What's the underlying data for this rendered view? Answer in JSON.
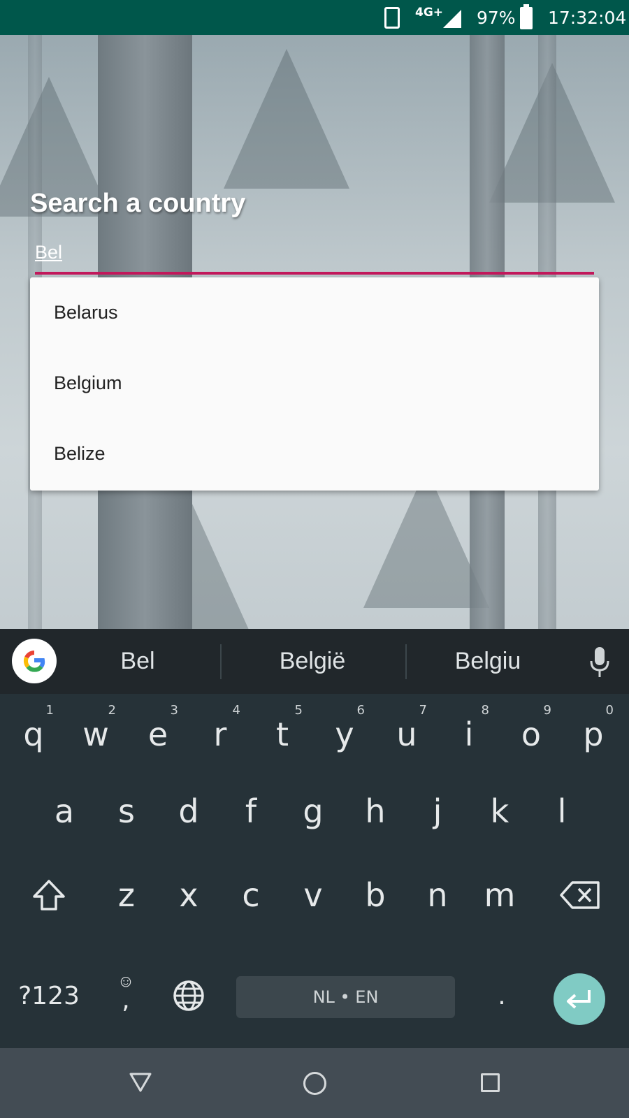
{
  "status_bar": {
    "network": "4G+",
    "battery": "97%",
    "time": "17:32:04"
  },
  "page": {
    "title": "Search a country",
    "search_value": "Bel"
  },
  "dropdown": {
    "items": [
      "Belarus",
      "Belgium",
      "Belize"
    ]
  },
  "keyboard": {
    "suggestions": [
      "Bel",
      "België",
      "Belgiu"
    ],
    "row1": [
      {
        "key": "q",
        "hint": "1"
      },
      {
        "key": "w",
        "hint": "2"
      },
      {
        "key": "e",
        "hint": "3"
      },
      {
        "key": "r",
        "hint": "4"
      },
      {
        "key": "t",
        "hint": "5"
      },
      {
        "key": "y",
        "hint": "6"
      },
      {
        "key": "u",
        "hint": "7"
      },
      {
        "key": "i",
        "hint": "8"
      },
      {
        "key": "o",
        "hint": "9"
      },
      {
        "key": "p",
        "hint": "0"
      }
    ],
    "row2": [
      "a",
      "s",
      "d",
      "f",
      "g",
      "h",
      "j",
      "k",
      "l"
    ],
    "row3": [
      "z",
      "x",
      "c",
      "v",
      "b",
      "n",
      "m"
    ],
    "symbols_label": "?123",
    "comma_label": ",",
    "space_label": "NL • EN",
    "period_label": "."
  },
  "colors": {
    "status_bar": "#00574b",
    "accent": "#c2185b",
    "enter_key": "#80cbc4",
    "keyboard_bg": "#263238"
  }
}
